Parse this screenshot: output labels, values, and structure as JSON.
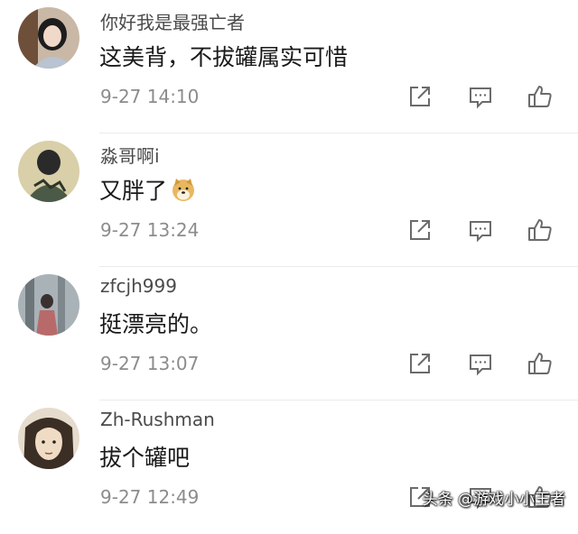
{
  "comments": [
    {
      "username": "你好我是最强亡者",
      "text": "这美背，不拔罐属实可惜",
      "time": "9-27 14:10"
    },
    {
      "username": "淼哥啊i",
      "text": "又胖了",
      "time": "9-27 13:24",
      "emoji": "doge-emoji"
    },
    {
      "username": "zfcjh999",
      "text": "挺漂亮的。",
      "time": "9-27 13:07"
    },
    {
      "username": "Zh-Rushman",
      "text": "拔个罐吧",
      "time": "9-27 12:49"
    }
  ],
  "actions": {
    "share_icon": "share-icon",
    "reply_icon": "comment-icon",
    "like_icon": "thumbs-up-icon"
  },
  "watermark": "头条 @游戏小小王者",
  "colors": {
    "username": "#4a4a4a",
    "text": "#1a1a1a",
    "time": "#8c8c8c",
    "icon": "#6b6b6b"
  }
}
